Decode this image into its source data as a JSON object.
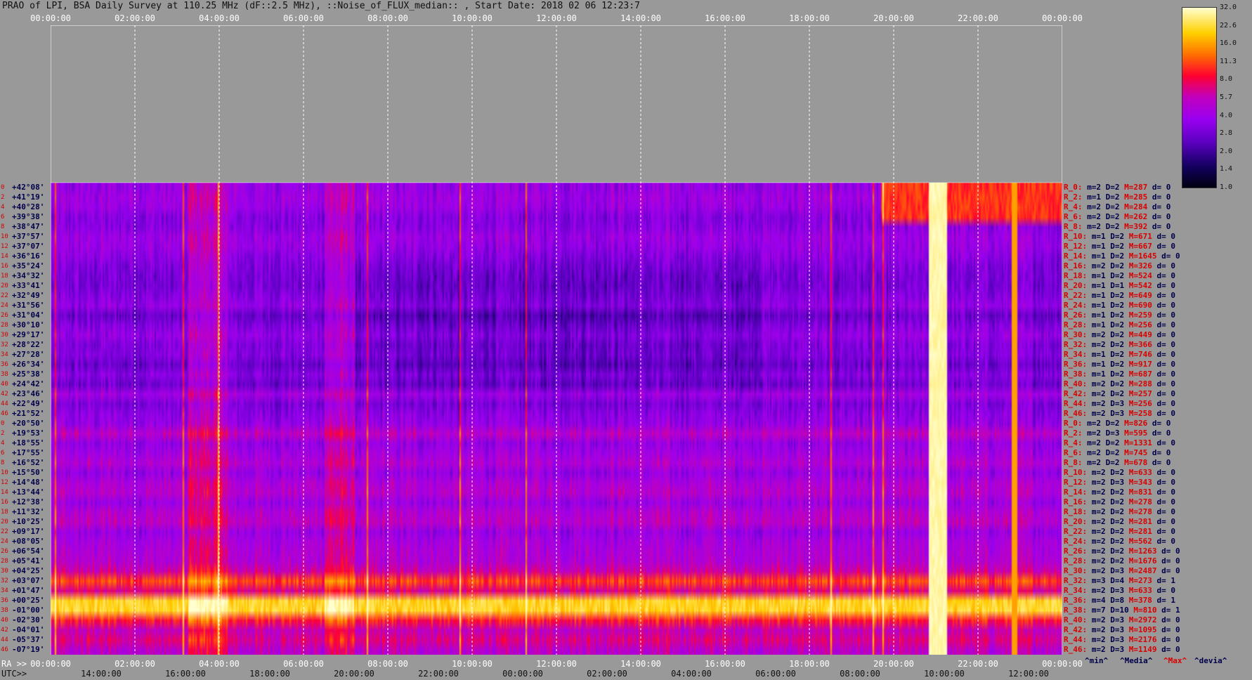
{
  "title": "PRAO of LPI, BSA Daily Survey at 110.25 MHz (dF::2.5 MHz), ::Noise_of_FLUX_median:: , Start Date: 2018 02 06 12:23:7",
  "chart_data": {
    "type": "heatmap",
    "title": "PRAO of LPI, BSA Daily Survey at 110.25 MHz (dF::2.5 MHz), ::Noise_of_FLUX_median:: , Start Date: 2018 02 06 12:23:7",
    "top_axis_ticks": [
      "00:00:00",
      "02:00:00",
      "04:00:00",
      "06:00:00",
      "08:00:00",
      "10:00:00",
      "12:00:00",
      "14:00:00",
      "16:00:00",
      "18:00:00",
      "20:00:00",
      "22:00:00",
      "00:00:00"
    ],
    "ra_axis_label": "RA >>",
    "ra_ticks": [
      "00:00:00",
      "02:00:00",
      "04:00:00",
      "06:00:00",
      "08:00:00",
      "10:00:00",
      "12:00:00",
      "14:00:00",
      "16:00:00",
      "18:00:00",
      "20:00:00",
      "22:00:00",
      "00:00:00"
    ],
    "utc_axis_label": "UTC>>",
    "utc_ticks": [
      "14:00:00",
      "16:00:00",
      "18:00:00",
      "20:00:00",
      "22:00:00",
      "00:00:00",
      "02:00:00",
      "04:00:00",
      "06:00:00",
      "08:00:00",
      "10:00:00",
      "12:00:00"
    ],
    "row_indices": [
      "0",
      "2",
      "4",
      "6",
      "8",
      "10",
      "12",
      "14",
      "16",
      "18",
      "20",
      "22",
      "24",
      "26",
      "28",
      "30",
      "32",
      "34",
      "36",
      "38",
      "40",
      "42",
      "44",
      "46",
      "0",
      "2",
      "4",
      "6",
      "8",
      "10",
      "12",
      "14",
      "16",
      "18",
      "20",
      "22",
      "24",
      "26",
      "28",
      "30",
      "32",
      "34",
      "36",
      "38",
      "40",
      "42",
      "44",
      "46"
    ],
    "declinations": [
      "+42°08'",
      "+41°19'",
      "+40°28'",
      "+39°38'",
      "+38°47'",
      "+37°57'",
      "+37°07'",
      "+36°16'",
      "+35°24'",
      "+34°32'",
      "+33°41'",
      "+32°49'",
      "+31°56'",
      "+31°04'",
      "+30°10'",
      "+29°17'",
      "+28°22'",
      "+27°28'",
      "+26°34'",
      "+25°38'",
      "+24°42'",
      "+23°46'",
      "+22°49'",
      "+21°52'",
      "+20°50'",
      "+19°53'",
      "+18°55'",
      "+17°55'",
      "+16°52'",
      "+15°50'",
      "+14°48'",
      "+13°44'",
      "+12°38'",
      "+11°32'",
      "+10°25'",
      "+09°17'",
      "+08°05'",
      "+06°54'",
      "+05°41'",
      "+04°25'",
      "+03°07'",
      "+01°47'",
      "+00°25'",
      "-01°00'",
      "-02°30'",
      "-04°01'",
      "-05°37'",
      "-07°19'"
    ],
    "row_stats": [
      {
        "ray": "R_0:",
        "min": "m=2",
        "med": "D=2",
        "max": "M=287",
        "dev": "d= 0"
      },
      {
        "ray": "R_2:",
        "min": "m=1",
        "med": "D=2",
        "max": "M=285",
        "dev": "d= 0"
      },
      {
        "ray": "R_4:",
        "min": "m=2",
        "med": "D=2",
        "max": "M=284",
        "dev": "d= 0"
      },
      {
        "ray": "R_6:",
        "min": "m=2",
        "med": "D=2",
        "max": "M=262",
        "dev": "d= 0"
      },
      {
        "ray": "R_8:",
        "min": "m=2",
        "med": "D=2",
        "max": "M=392",
        "dev": "d= 0"
      },
      {
        "ray": "R_10:",
        "min": "m=1",
        "med": "D=2",
        "max": "M=671",
        "dev": "d= 0"
      },
      {
        "ray": "R_12:",
        "min": "m=1",
        "med": "D=2",
        "max": "M=667",
        "dev": "d= 0"
      },
      {
        "ray": "R_14:",
        "min": "m=1",
        "med": "D=2",
        "max": "M=1645",
        "dev": "d= 0"
      },
      {
        "ray": "R_16:",
        "min": "m=2",
        "med": "D=2",
        "max": "M=326",
        "dev": "d= 0"
      },
      {
        "ray": "R_18:",
        "min": "m=1",
        "med": "D=2",
        "max": "M=524",
        "dev": "d= 0"
      },
      {
        "ray": "R_20:",
        "min": "m=1",
        "med": "D=1",
        "max": "M=542",
        "dev": "d= 0"
      },
      {
        "ray": "R_22:",
        "min": "m=1",
        "med": "D=2",
        "max": "M=649",
        "dev": "d= 0"
      },
      {
        "ray": "R_24:",
        "min": "m=1",
        "med": "D=2",
        "max": "M=690",
        "dev": "d= 0"
      },
      {
        "ray": "R_26:",
        "min": "m=1",
        "med": "D=2",
        "max": "M=259",
        "dev": "d= 0"
      },
      {
        "ray": "R_28:",
        "min": "m=1",
        "med": "D=2",
        "max": "M=256",
        "dev": "d= 0"
      },
      {
        "ray": "R_30:",
        "min": "m=2",
        "med": "D=2",
        "max": "M=449",
        "dev": "d= 0"
      },
      {
        "ray": "R_32:",
        "min": "m=2",
        "med": "D=2",
        "max": "M=366",
        "dev": "d= 0"
      },
      {
        "ray": "R_34:",
        "min": "m=1",
        "med": "D=2",
        "max": "M=746",
        "dev": "d= 0"
      },
      {
        "ray": "R_36:",
        "min": "m=1",
        "med": "D=2",
        "max": "M=917",
        "dev": "d= 0"
      },
      {
        "ray": "R_38:",
        "min": "m=1",
        "med": "D=2",
        "max": "M=687",
        "dev": "d= 0"
      },
      {
        "ray": "R_40:",
        "min": "m=2",
        "med": "D=2",
        "max": "M=288",
        "dev": "d= 0"
      },
      {
        "ray": "R_42:",
        "min": "m=2",
        "med": "D=2",
        "max": "M=257",
        "dev": "d= 0"
      },
      {
        "ray": "R_44:",
        "min": "m=2",
        "med": "D=3",
        "max": "M=256",
        "dev": "d= 0"
      },
      {
        "ray": "R_46:",
        "min": "m=2",
        "med": "D=3",
        "max": "M=258",
        "dev": "d= 0"
      },
      {
        "ray": "R_0:",
        "min": "m=2",
        "med": "D=2",
        "max": "M=826",
        "dev": "d= 0"
      },
      {
        "ray": "R_2:",
        "min": "m=2",
        "med": "D=3",
        "max": "M=595",
        "dev": "d= 0"
      },
      {
        "ray": "R_4:",
        "min": "m=2",
        "med": "D=2",
        "max": "M=1331",
        "dev": "d= 0"
      },
      {
        "ray": "R_6:",
        "min": "m=2",
        "med": "D=2",
        "max": "M=745",
        "dev": "d= 0"
      },
      {
        "ray": "R_8:",
        "min": "m=2",
        "med": "D=2",
        "max": "M=678",
        "dev": "d= 0"
      },
      {
        "ray": "R_10:",
        "min": "m=2",
        "med": "D=2",
        "max": "M=633",
        "dev": "d= 0"
      },
      {
        "ray": "R_12:",
        "min": "m=2",
        "med": "D=3",
        "max": "M=343",
        "dev": "d= 0"
      },
      {
        "ray": "R_14:",
        "min": "m=2",
        "med": "D=2",
        "max": "M=831",
        "dev": "d= 0"
      },
      {
        "ray": "R_16:",
        "min": "m=2",
        "med": "D=2",
        "max": "M=278",
        "dev": "d= 0"
      },
      {
        "ray": "R_18:",
        "min": "m=2",
        "med": "D=2",
        "max": "M=278",
        "dev": "d= 0"
      },
      {
        "ray": "R_20:",
        "min": "m=2",
        "med": "D=2",
        "max": "M=281",
        "dev": "d= 0"
      },
      {
        "ray": "R_22:",
        "min": "m=2",
        "med": "D=2",
        "max": "M=281",
        "dev": "d= 0"
      },
      {
        "ray": "R_24:",
        "min": "m=2",
        "med": "D=2",
        "max": "M=562",
        "dev": "d= 0"
      },
      {
        "ray": "R_26:",
        "min": "m=2",
        "med": "D=2",
        "max": "M=1263",
        "dev": "d= 0"
      },
      {
        "ray": "R_28:",
        "min": "m=2",
        "med": "D=2",
        "max": "M=1676",
        "dev": "d= 0"
      },
      {
        "ray": "R_30:",
        "min": "m=2",
        "med": "D=3",
        "max": "M=2487",
        "dev": "d= 0"
      },
      {
        "ray": "R_32:",
        "min": "m=3",
        "med": "D=4",
        "max": "M=273",
        "dev": "d= 1"
      },
      {
        "ray": "R_34:",
        "min": "m=2",
        "med": "D=3",
        "max": "M=633",
        "dev": "d= 0"
      },
      {
        "ray": "R_36:",
        "min": "m=4",
        "med": "D=8",
        "max": "M=378",
        "dev": "d= 1"
      },
      {
        "ray": "R_38:",
        "min": "m=7",
        "med": "D=10",
        "max": "M=810",
        "dev": "d= 1"
      },
      {
        "ray": "R_40:",
        "min": "m=2",
        "med": "D=3",
        "max": "M=2972",
        "dev": "d= 0"
      },
      {
        "ray": "R_42:",
        "min": "m=2",
        "med": "D=3",
        "max": "M=1095",
        "dev": "d= 0"
      },
      {
        "ray": "R_44:",
        "min": "m=2",
        "med": "D=3",
        "max": "M=2176",
        "dev": "d= 0"
      },
      {
        "ray": "R_46:",
        "min": "m=2",
        "med": "D=3",
        "max": "M=1149",
        "dev": "d= 0"
      }
    ],
    "colorbar_ticks": [
      "32.0",
      "22.6",
      "16.0",
      "11.3",
      "8.0",
      "5.7",
      "4.0",
      "2.8",
      "2.0",
      "1.4",
      "1.0"
    ],
    "colorbar_range": [
      1.0,
      32.0
    ],
    "colorbar_scale": "log",
    "stats_legend": [
      "^min^",
      "^Media^",
      "^Max^",
      "^devia^"
    ],
    "colors": {
      "low": "#000010",
      "mid": "#9a00f0",
      "high": "#ff0030",
      "peak": "#ffffd0",
      "label_red": "#d80000",
      "label_navy": "#00004a"
    },
    "grid": true
  }
}
